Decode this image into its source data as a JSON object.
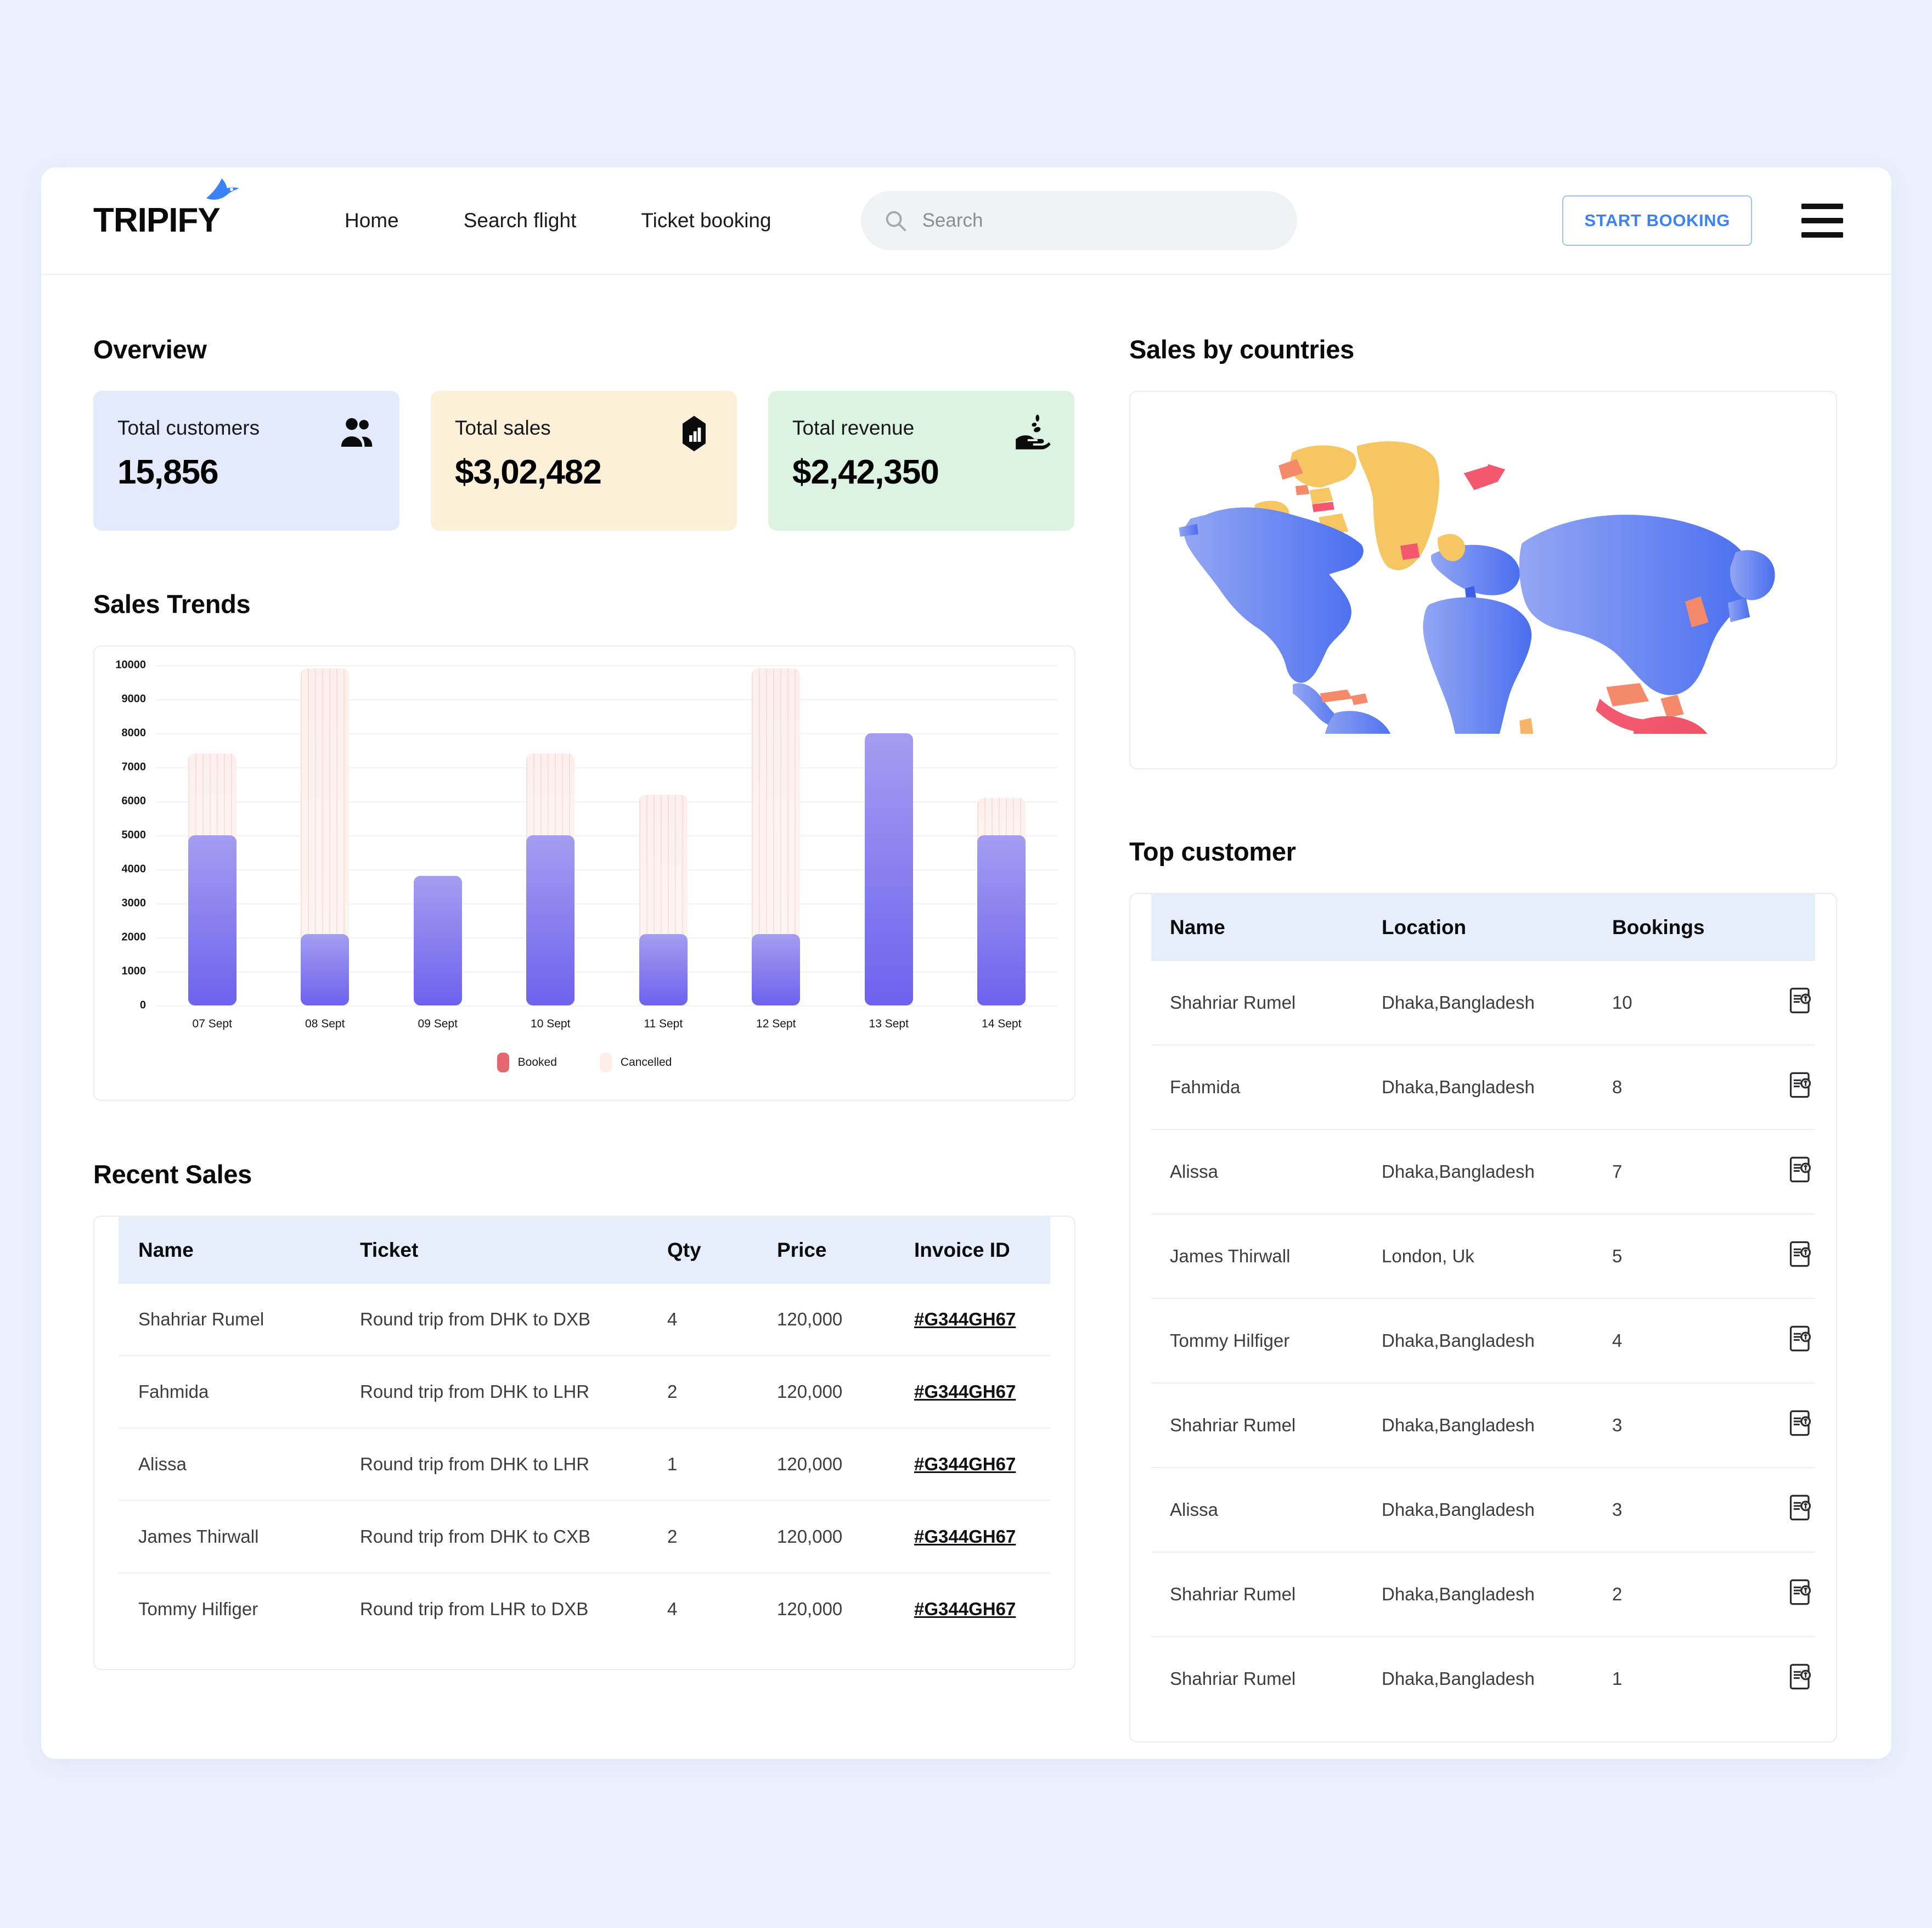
{
  "brand": {
    "name": "TRIPIFY",
    "bird_icon": "bird-icon",
    "accent": "#3b82f6"
  },
  "nav": {
    "items": [
      {
        "label": "Home"
      },
      {
        "label": "Search flight"
      },
      {
        "label": "Ticket booking"
      }
    ]
  },
  "search": {
    "placeholder": "Search",
    "value": "",
    "icon": "search-icon"
  },
  "header_actions": {
    "start_booking_label": "START BOOKING",
    "menu_icon": "hamburger-menu-icon"
  },
  "overview": {
    "title": "Overview",
    "cards": [
      {
        "label": "Total customers",
        "value": "15,856",
        "icon": "people-icon",
        "bg": "#e2eafb"
      },
      {
        "label": "Total sales",
        "value": "$3,02,482",
        "icon": "bar-chart-icon",
        "bg": "#fcf1d8"
      },
      {
        "label": "Total revenue",
        "value": "$2,42,350",
        "icon": "hand-coins-icon",
        "bg": "#dcf3e2"
      }
    ]
  },
  "sales_trends": {
    "title": "Sales Trends"
  },
  "chart_data": {
    "type": "bar",
    "title": "Sales Trends",
    "xlabel": "",
    "ylabel": "",
    "ylim": [
      0,
      10000
    ],
    "yticks": [
      0,
      1000,
      2000,
      3000,
      4000,
      5000,
      6000,
      7000,
      8000,
      9000,
      10000
    ],
    "grid": true,
    "legend_position": "bottom",
    "categories": [
      "07 Sept",
      "08 Sept",
      "09 Sept",
      "10 Sept",
      "11 Sept",
      "12 Sept",
      "13 Sept",
      "14 Sept"
    ],
    "series": [
      {
        "name": "Booked",
        "color": "#6d62ee",
        "values": [
          5000,
          2100,
          3800,
          5000,
          2100,
          2100,
          8000,
          5000
        ]
      },
      {
        "name": "Cancelled",
        "color": "#fdf0ec",
        "values": [
          2400,
          7800,
          0,
          2400,
          4100,
          7800,
          0,
          1100
        ]
      }
    ],
    "stacked": true,
    "totals": [
      7400,
      9900,
      3800,
      7400,
      6200,
      9900,
      8000,
      6100
    ]
  },
  "recent_sales": {
    "title": "Recent Sales",
    "columns": [
      "Name",
      "Ticket",
      "Qty",
      "Price",
      "Invoice ID"
    ],
    "rows": [
      {
        "name": "Shahriar Rumel",
        "ticket": "Round trip from DHK to DXB",
        "qty": "4",
        "price": "120,000",
        "invoice": "#G344GH67"
      },
      {
        "name": "Fahmida",
        "ticket": "Round trip from DHK to LHR",
        "qty": "2",
        "price": "120,000",
        "invoice": "#G344GH67"
      },
      {
        "name": "Alissa",
        "ticket": "Round trip from DHK to LHR",
        "qty": "1",
        "price": "120,000",
        "invoice": "#G344GH67"
      },
      {
        "name": "James Thirwall",
        "ticket": "Round trip from DHK to CXB",
        "qty": "2",
        "price": "120,000",
        "invoice": "#G344GH67"
      },
      {
        "name": "Tommy Hilfiger",
        "ticket": "Round trip from LHR to DXB",
        "qty": "4",
        "price": "120,000",
        "invoice": "#G344GH67"
      }
    ]
  },
  "sales_by_countries": {
    "title": "Sales by countries",
    "map_colors": {
      "continent_blue": "#6f8ef0",
      "arctic_yellow": "#f6c663",
      "highlight_red": "#f2596f",
      "accent_orange": "#f58a6b"
    }
  },
  "top_customer": {
    "title": "Top customer",
    "columns": [
      "Name",
      "Location",
      "Bookings"
    ],
    "detail_icon": "receipt-document-icon",
    "rows": [
      {
        "name": "Shahriar Rumel",
        "location": "Dhaka,Bangladesh",
        "bookings": "10"
      },
      {
        "name": "Fahmida",
        "location": "Dhaka,Bangladesh",
        "bookings": "8"
      },
      {
        "name": "Alissa",
        "location": "Dhaka,Bangladesh",
        "bookings": "7"
      },
      {
        "name": "James Thirwall",
        "location": "London, Uk",
        "bookings": "5"
      },
      {
        "name": "Tommy Hilfiger",
        "location": "Dhaka,Bangladesh",
        "bookings": "4"
      },
      {
        "name": "Shahriar Rumel",
        "location": "Dhaka,Bangladesh",
        "bookings": "3"
      },
      {
        "name": "Alissa",
        "location": "Dhaka,Bangladesh",
        "bookings": "3"
      },
      {
        "name": "Shahriar Rumel",
        "location": "Dhaka,Bangladesh",
        "bookings": "2"
      },
      {
        "name": "Shahriar Rumel",
        "location": "Dhaka,Bangladesh",
        "bookings": "1"
      }
    ]
  }
}
